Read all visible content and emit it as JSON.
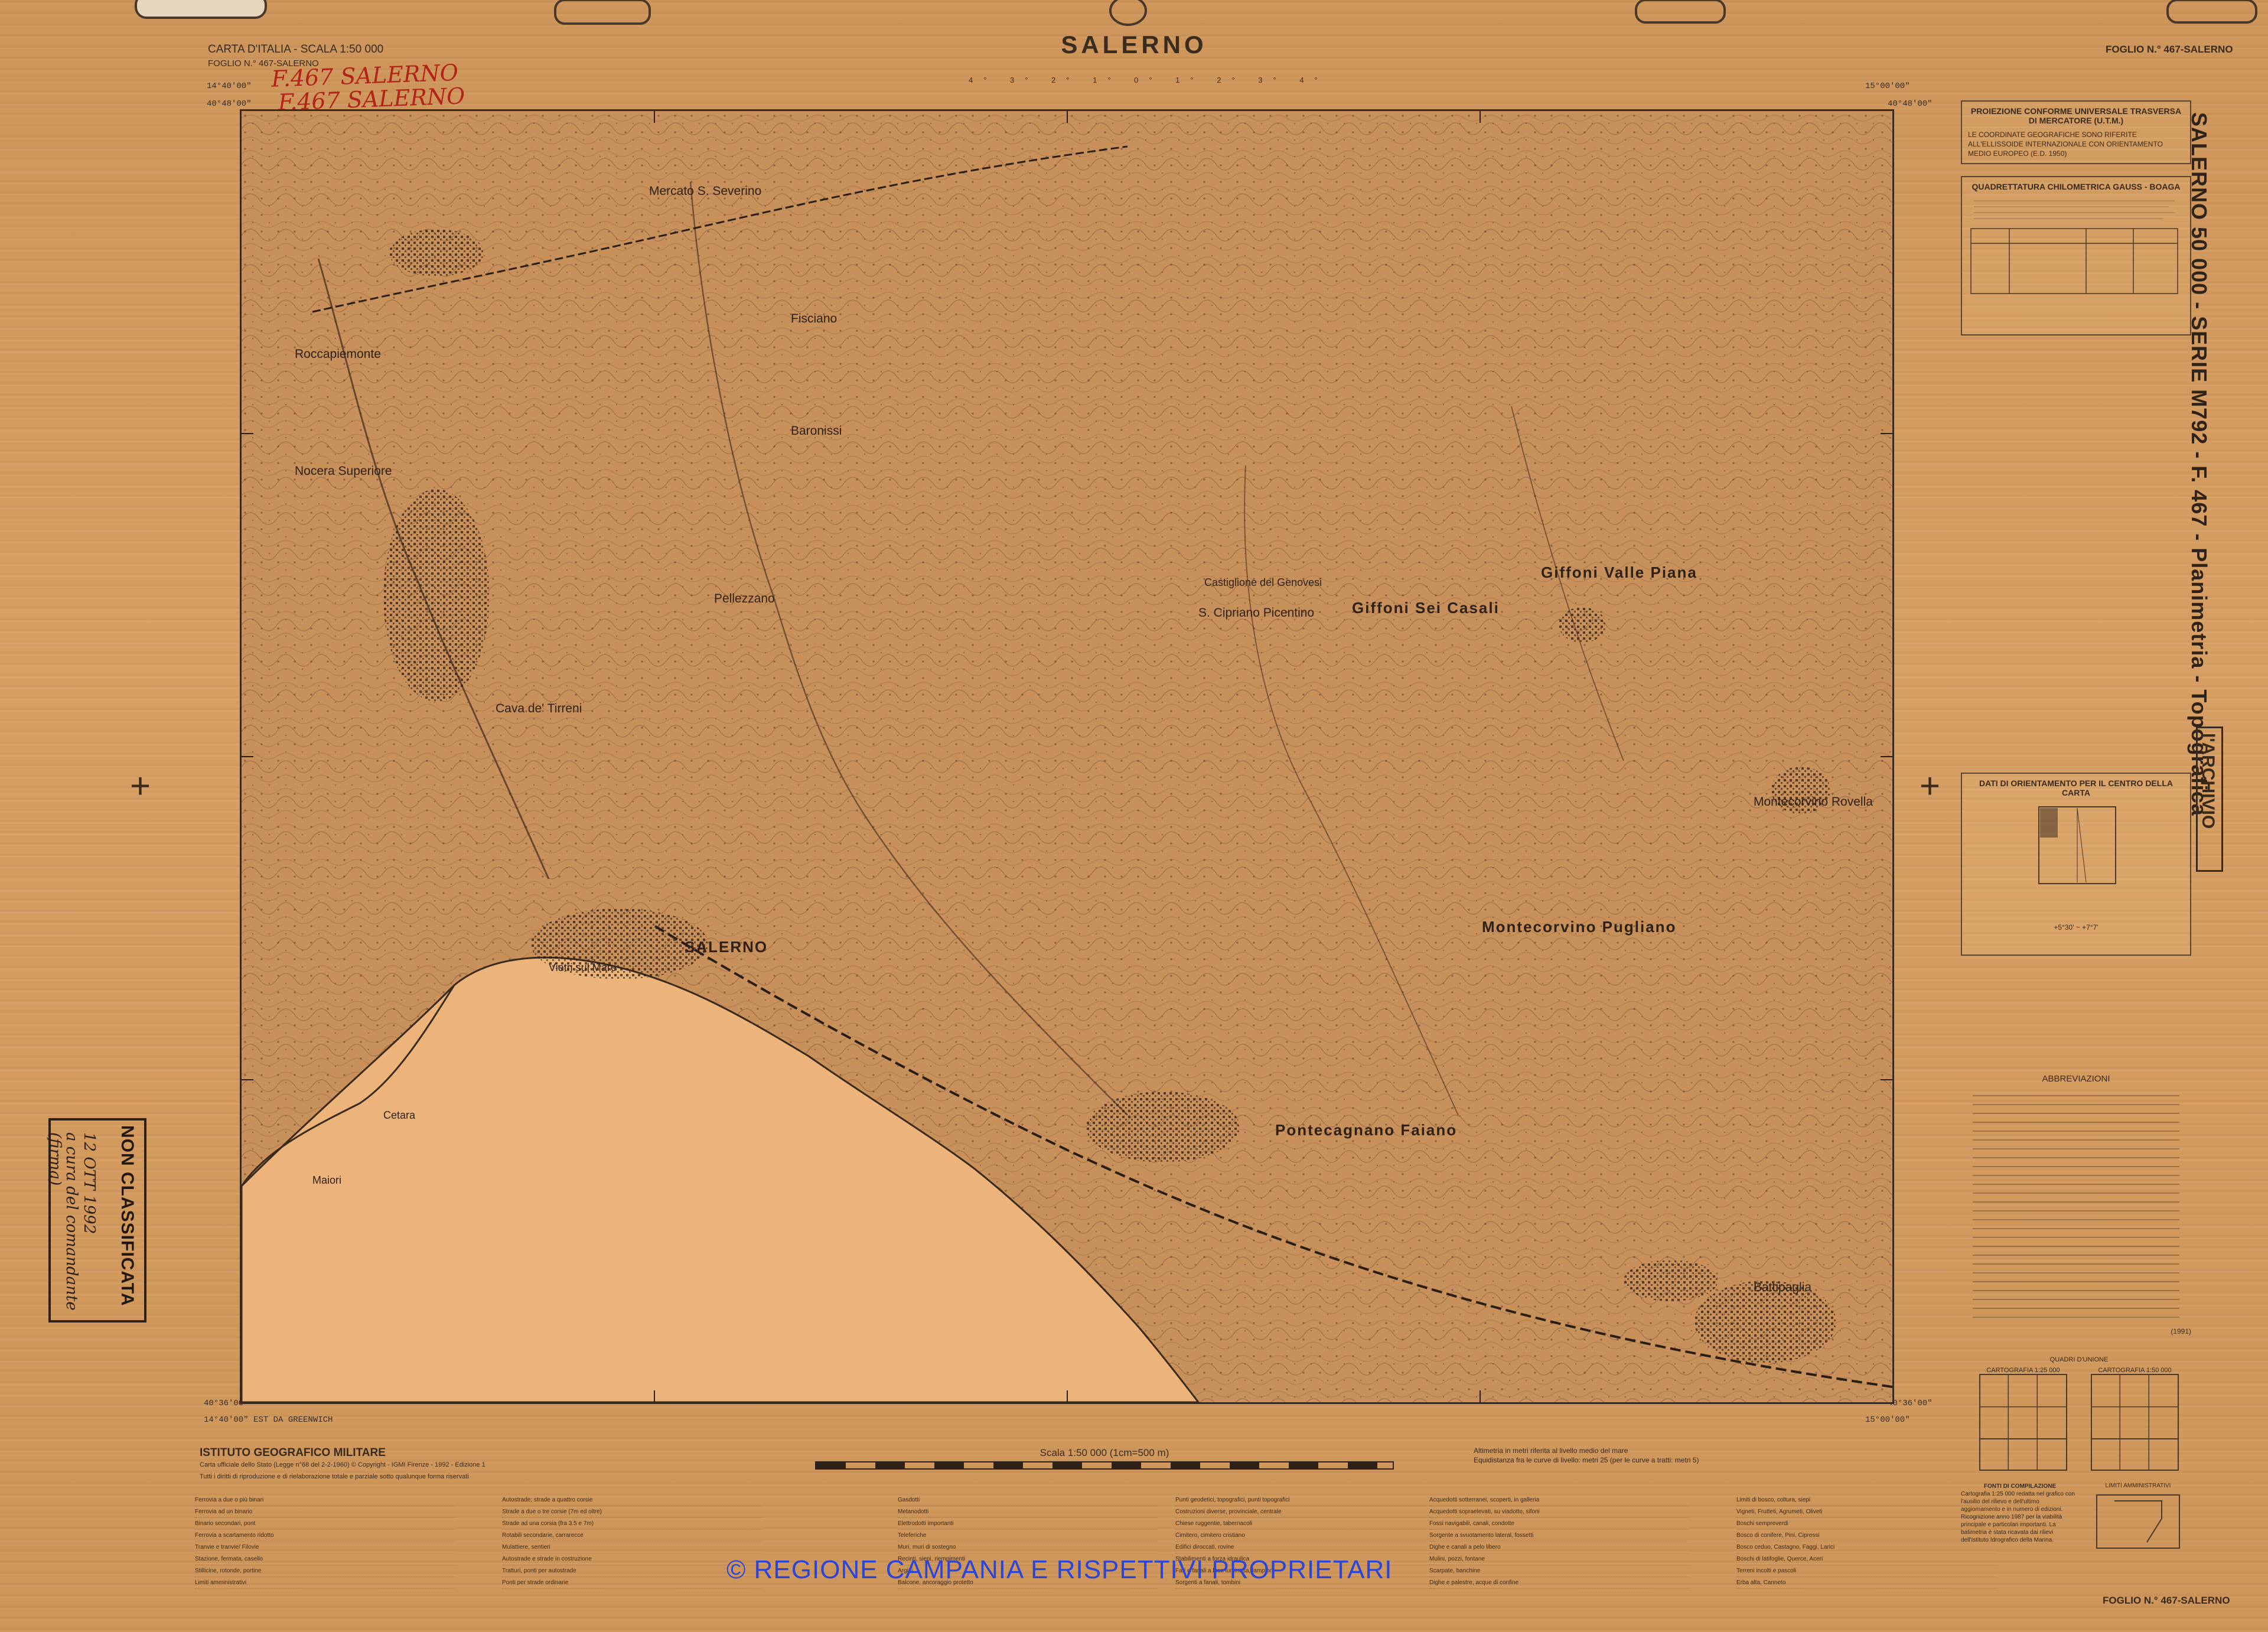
{
  "map": {
    "title": "SALERNO",
    "series_line": "CARTA D'ITALIA - SCALA 1:50 000",
    "sheet_line": "FOGLIO N.° 467-SALERNO",
    "sheet_right": "FOGLIO N.° 467-SALERNO",
    "sheet_footer": "FOGLIO N.° 467-SALERNO",
    "handwritten_note": [
      "F.467 SALERNO",
      "F.467 SALERNO"
    ],
    "coords": {
      "top_left_lon": "14°40'00\"",
      "top_left_lat": "40°48'00\"",
      "top_right_lon": "15°00'00\"",
      "top_right_lat": "40°48'00\"",
      "bottom_left_lat": "40°36'00\"",
      "bottom_left_lon": "14°40'00\" EST DA GREENWICH",
      "bottom_right_lat": "40°36'00\"",
      "bottom_right_lon": "15°00'00\""
    },
    "top_scale_ticks": "4° 3° 2° 1° 0° 1° 2° 3° 4°",
    "sea_color": "#ecb47a",
    "land_color": "#c8905a",
    "line_color": "#3a2a1c",
    "places": [
      "Mercato S. Severino",
      "Roccapiemonte",
      "Nocera Superiore",
      "Baronissi",
      "Pellezzano",
      "Castiglione del Genovesi",
      "S. Cipriano Picentino",
      "Giffoni Sei Casali",
      "Giffoni Valle Piana",
      "Cava de' Tirreni",
      "SALERNO",
      "Vietri sul Mare",
      "Montecorvino Rovella",
      "Montecorvino Pugliano",
      "Pontecagnano Faiano",
      "Battipaglia",
      "Cetara",
      "Maiori",
      "Fisciano"
    ]
  },
  "sidebar": {
    "vertical_title": "SALERNO 50 000 - SERIE M792 - F. 467 - Planimetria - Topografica",
    "archivio": "l'ARCHIVIO",
    "projection": "PROIEZIONE CONFORME UNIVERSALE TRASVERSA DI MERCATORE (U.T.M.)",
    "projection_note": "LE COORDINATE GEOGRAFICHE SONO RIFERITE ALL'ELLISSOIDE INTERNAZIONALE CON ORIENTAMENTO MEDIO EUROPEO (E.D. 1950)",
    "quadrettatura": "QUADRETTATURA CHILOMETRICA GAUSS - BOAGA",
    "orientamento": "DATI DI ORIENTAMENTO PER IL CENTRO DELLA CARTA",
    "declination": "+5°30' ~ +7°7'",
    "abbreviazioni": "ABBREVIAZIONI",
    "quadri": "QUADRI D'UNIONE",
    "quadri_sub": [
      "CARTOGRAFIA 1:25 000",
      "CARTOGRAFIA 1:50 000"
    ],
    "fonti": "FONTI DI COMPILAZIONE",
    "fonti_text": "Cartografia 1:25 000 redatta nel grafico con l'ausilio del rilievo e dell'ultimo aggiornamento e in numero di edizioni. Ricognizione anno 1987 per la viabilità principale e particolari importanti. La batimetria è stata ricavata dai rilievi dell'Istituto Idrografico della Marina.",
    "limiti": "LIMITI AMMINISTRATIVI",
    "year": "(1991)"
  },
  "footer": {
    "institute": "ISTITUTO GEOGRAFICO MILITARE",
    "rights_1": "Carta ufficiale dello Stato (Legge n°68 del 2-2-1960) © Copyright - IGMI Firenze - 1992 - Edizione 1",
    "rights_2": "Tutti i diritti di riproduzione e di rielaborazione totale e parziale sotto qualunque forma riservati",
    "scale_text": "Scala 1:50 000 (1cm=500 m)",
    "alt_note_1": "Altimetria in metri riferita al livello medio del mare",
    "alt_note_2": "Equidistanza fra le curve di livello: metri 25 (per le curve a tratti: metri 5)",
    "copyright": "© REGIONE CAMPANIA E RISPETTIVI PROPRIETARI"
  },
  "stamp": {
    "text": "NON CLASSIFICATA",
    "hand_1": "12 OTT 1992",
    "hand_2": "a cura del comandante",
    "hand_3": "(firma)"
  },
  "legend": {
    "col1": [
      "Ferrovia a due o più binari",
      "Ferrovia ad un binario",
      "Binario secondari, pont",
      "Ferrovia a scartamento ridotto",
      "Tranvie e tranvie/ Filovie",
      "Stazione, fermata, casello",
      "Stillicine, rotonde, portine",
      "Limiti amministrativi"
    ],
    "col2": [
      "Autostrade; strade a quattro corsie",
      "Strade a due o tre corsie (7m ed oltre)",
      "Strade ad una corsia (fra 3.5 e 7m)",
      "Rotabili secondarie, carrarecce",
      "Mulattiere, sentieri",
      "Autostrade e strade in costruzione",
      "Tratturi, ponti per autostrade",
      "Ponti per strade ordinarie"
    ],
    "col3": [
      "Gasdotti",
      "Metanodotti",
      "Elettrodotti importanti",
      "Teleferiche",
      "Muri, muri di sostegno",
      "Recinti, siepi, riempimenti",
      "Argini",
      "Balcone, ancoraggio protetto"
    ],
    "col4": [
      "Punti geodetici, topografici, punti topografici",
      "Costruzioni diverse, provinciale, centrale",
      "Chiese ruggentie, tabernacoli",
      "Cimitero, cimitero cristiano",
      "Edifici diroccati, rovine",
      "Stabilimenti a forza idraulica",
      "Fari e fanali a luce luminosa, lampioni",
      "Sorgenti a fanali, tombini"
    ],
    "col5": [
      "Acquedotti sotterranei, scoperti, in galleria",
      "Acquedotti sopraelevati, su viadotto, sifoni",
      "Fossi navigabili, canali, condotte",
      "Sorgente a svuotamento lateral, fossetti",
      "Dighe e canali a pelo libero",
      "Mulini, pozzi, fontane",
      "Scarpate, banchine",
      "Dighe e palestre, acque di confine"
    ],
    "col6": [
      "Limiti di bosco, coltura, siepi",
      "Vigneti, Frutteti, Agrumeti, Oliveti",
      "Boschi sempreverdi",
      "Bosco di conifere, Pini, Cipressi",
      "Bosco ceduo, Castagno, Faggi, Larici",
      "Boschi di latifoglie, Querce, Aceri",
      "Terreni incolti e pascoli",
      "Erba alta, Canneto"
    ]
  }
}
